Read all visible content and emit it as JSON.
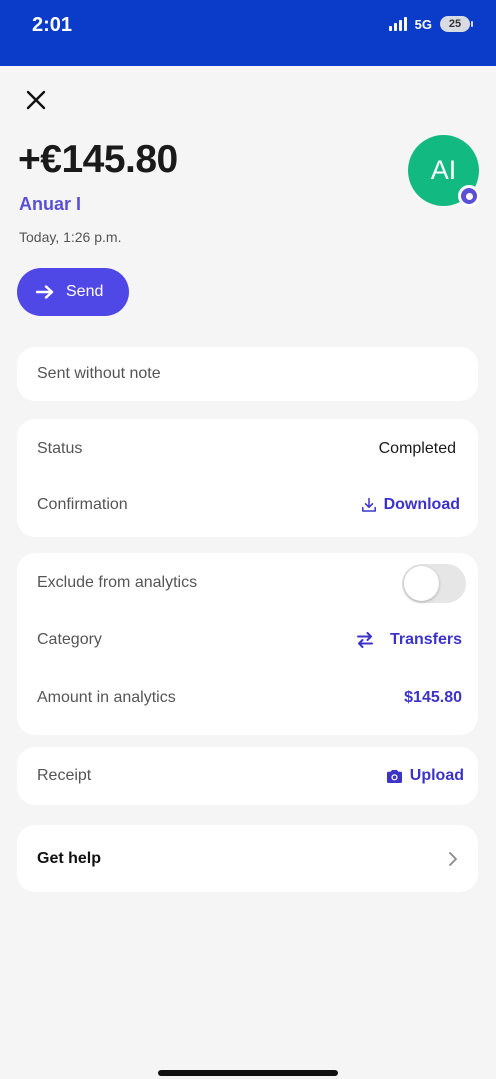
{
  "status_bar": {
    "time": "2:01",
    "network": "5G",
    "battery": "25"
  },
  "transaction": {
    "amount": "+€145.80",
    "counterparty": "Anuar I",
    "datetime": "Today, 1:26 p.m.",
    "avatar_initials": "AI",
    "avatar_color": "#12b981"
  },
  "actions": {
    "send_label": "Send"
  },
  "note": {
    "text": "Sent without note"
  },
  "details": {
    "status_label": "Status",
    "status_value": "Completed",
    "confirmation_label": "Confirmation",
    "download_label": "Download"
  },
  "analytics": {
    "exclude_label": "Exclude from analytics",
    "exclude_enabled": false,
    "category_label": "Category",
    "category_value": "Transfers",
    "amount_label": "Amount in analytics",
    "amount_value": "$145.80"
  },
  "receipt": {
    "label": "Receipt",
    "upload_label": "Upload"
  },
  "help": {
    "label": "Get help"
  },
  "colors": {
    "status_bar": "#0a3bc9",
    "accent": "#4f47e6",
    "link": "#3c33c9"
  }
}
